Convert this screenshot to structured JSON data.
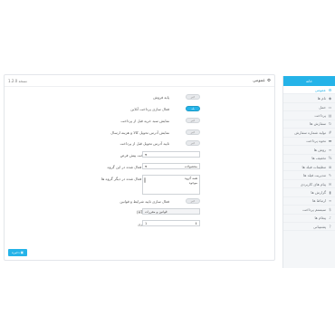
{
  "sidebar": {
    "header": "خانه",
    "items": [
      {
        "label": "عمومی",
        "icon": "gear-icon",
        "active": true
      },
      {
        "label": "نام ها",
        "icon": "tag-icon"
      },
      {
        "label": "حمل",
        "icon": "truck-icon"
      },
      {
        "label": "پرداخت",
        "icon": "cart-icon"
      },
      {
        "label": "سفارش ها",
        "icon": "refresh-icon"
      },
      {
        "label": "تولید شماره سفارش",
        "icon": "hash-icon"
      },
      {
        "label": "نحوه پرداخت",
        "icon": "credit-card-icon"
      },
      {
        "label": "روش ها",
        "icon": "list-icon"
      },
      {
        "label": "تخفیف ها",
        "icon": "percent-icon"
      },
      {
        "label": "تنظیمات فیلد ها",
        "icon": "sliders-icon"
      },
      {
        "label": "مدیریت فیلد ها",
        "icon": "edit-icon"
      },
      {
        "label": "پیام های کاربردی",
        "icon": "message-icon"
      },
      {
        "label": "گزارش ها",
        "icon": "chart-icon"
      },
      {
        "label": "ارتباط ها",
        "icon": "link-icon"
      },
      {
        "label": "سیستم پرداخت",
        "icon": "money-icon"
      },
      {
        "label": "پیغام ها",
        "icon": "bell-icon"
      },
      {
        "label": "پشتیبانی",
        "icon": "help-icon"
      }
    ]
  },
  "panel": {
    "title": "عمومی",
    "badge": "نسخه 1.2.0",
    "toggle_off": "خیر",
    "toggle_on": "بله",
    "rows": [
      {
        "label": "پایه فروش",
        "value": "خیر"
      },
      {
        "label": "فعال سازی پرداخت آنلاین",
        "value": "بله"
      },
      {
        "label": "نمایش سبد خرید قبل از پرداخت",
        "value": "خیر"
      },
      {
        "label": "نمایش آدرس تحویل کالا و هزینه ارسال",
        "value": "خیر"
      },
      {
        "label": "تایید آدرس تحویل قبل از پرداخت",
        "value": "خیر"
      }
    ],
    "select1": {
      "label": "گزینش روش پرداخت پیش فرض",
      "value": ""
    },
    "select2": {
      "label": "افزودن محصولات فعال شده در این گروه",
      "value": "محصولات"
    },
    "textarea": {
      "label": "افزودن محصولات فعال شده در دیگر گروه ها",
      "lines": [
        "همه گروه",
        "موجود"
      ]
    },
    "confirm_row": {
      "label": "فعال سازی تایید شرایط و قوانین",
      "value": "خیر"
    },
    "input": {
      "label": "صفحه محتوا (HTML)",
      "value": "قوانین و مقررات"
    },
    "spinner": {
      "label": "شناسه شماره گذاری",
      "value": "1"
    },
    "save_label": "ذخیره"
  },
  "colors": {
    "accent": "#25b3e8"
  }
}
